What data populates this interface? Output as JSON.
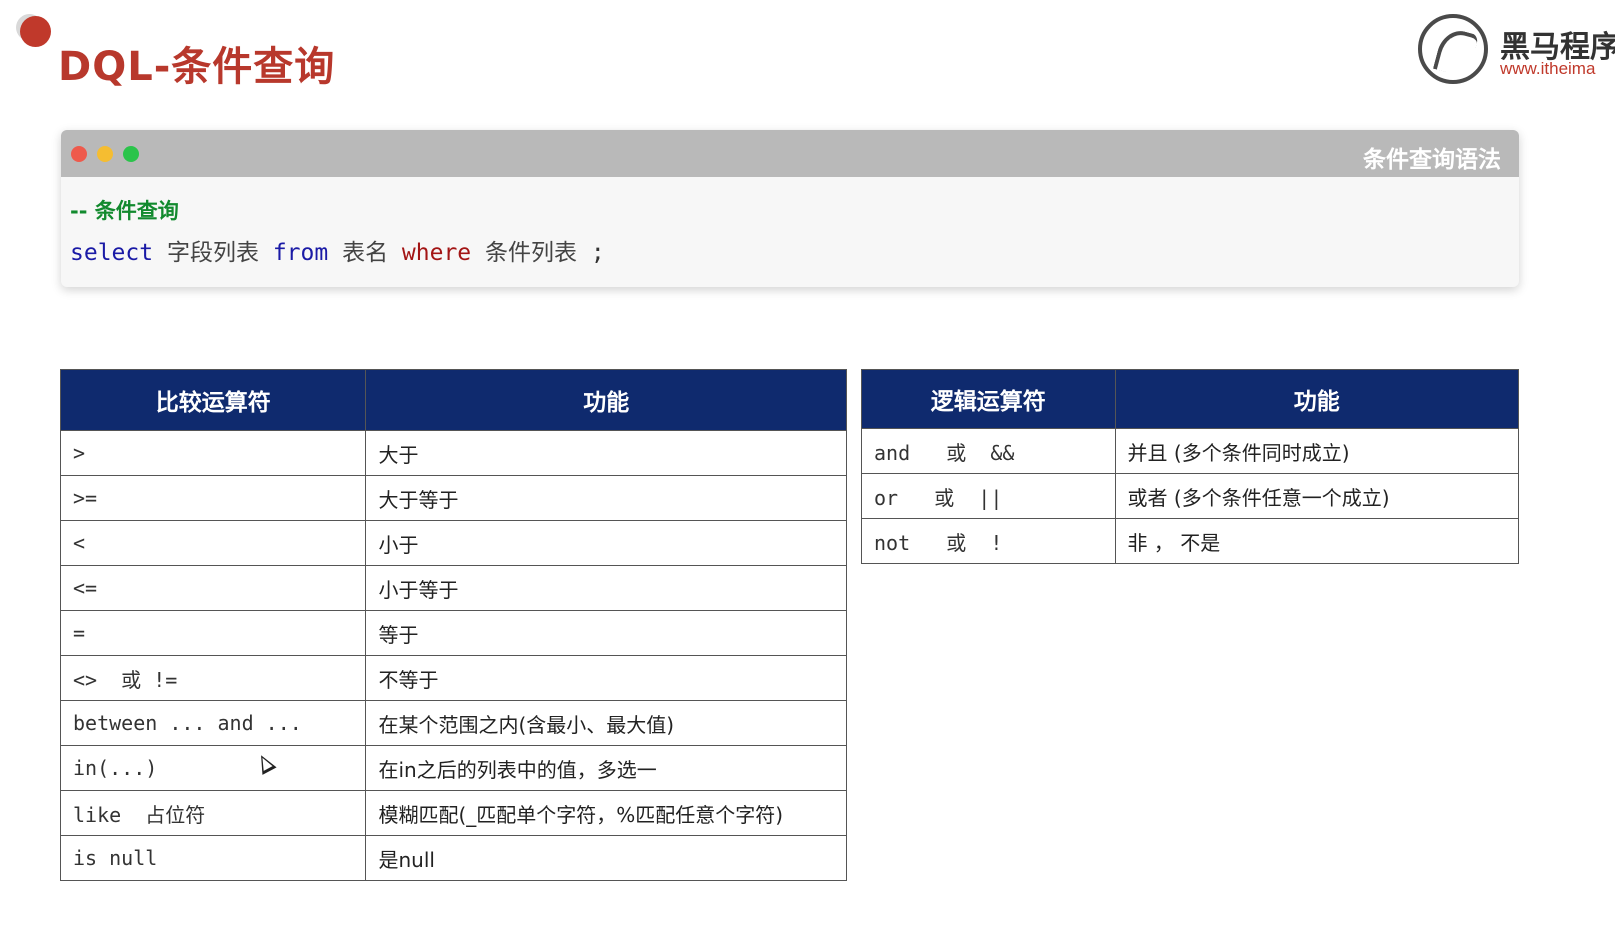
{
  "slide": {
    "title": "DQL-条件查询"
  },
  "logo": {
    "name": "黑马程序",
    "url": "www.itheima"
  },
  "code_window": {
    "title": "条件查询语法",
    "comment": "-- 条件查询",
    "line": {
      "kw_select": "select",
      "fields": "字段列表",
      "kw_from": "from",
      "table": "表名",
      "kw_where": "where",
      "condition": "条件列表",
      "terminator": ";"
    }
  },
  "comparison_table": {
    "headers": [
      "比较运算符",
      "功能"
    ],
    "rows": [
      [
        ">",
        "大于"
      ],
      [
        ">=",
        "大于等于"
      ],
      [
        "<",
        "小于"
      ],
      [
        "<=",
        "小于等于"
      ],
      [
        "=",
        "等于"
      ],
      [
        "<>  或 !=",
        "不等于"
      ],
      [
        "between ... and ...",
        "在某个范围之内(含最小、最大值)"
      ],
      [
        "in(...)",
        "在in之后的列表中的值，多选一"
      ],
      [
        "like  占位符",
        "模糊匹配(_匹配单个字符，%匹配任意个字符)"
      ],
      [
        "is null",
        "是null"
      ]
    ]
  },
  "logic_table": {
    "headers": [
      "逻辑运算符",
      "功能"
    ],
    "rows": [
      [
        "and   或  &&",
        "并且 (多个条件同时成立)"
      ],
      [
        "or   或  ||",
        "或者 (多个条件任意一个成立)"
      ],
      [
        "not   或  !",
        "非 ， 不是"
      ]
    ]
  },
  "colors": {
    "title_red": "#b8382c",
    "table_header_navy": "#0f2a6e",
    "keyword_blue": "#1a1aa6",
    "keyword_red": "#a31515",
    "comment_green": "#128a2e"
  }
}
